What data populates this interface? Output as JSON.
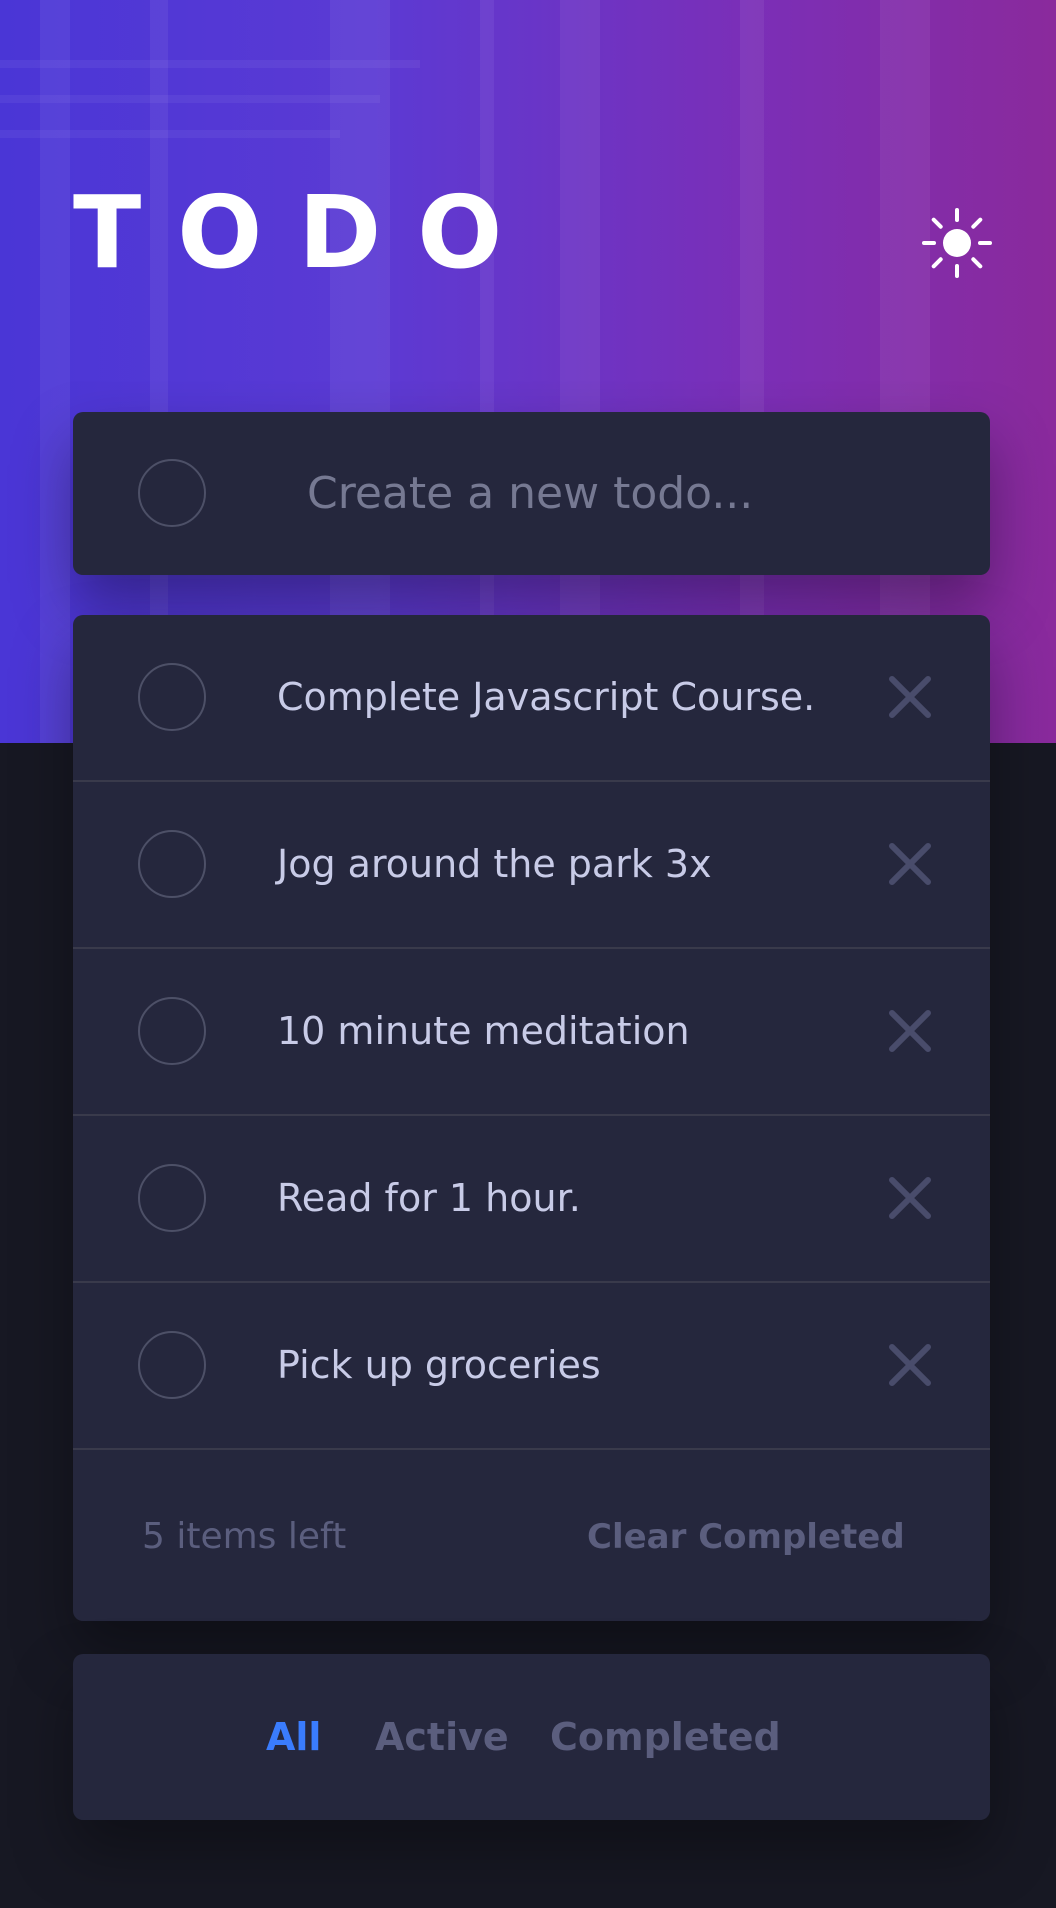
{
  "app": {
    "title": "TODO",
    "theme_icon": "sun-icon"
  },
  "new_todo": {
    "placeholder": "Create a new todo..."
  },
  "todos": [
    {
      "text": "Complete Javascript Course.",
      "completed": false
    },
    {
      "text": "Jog around the park 3x",
      "completed": false
    },
    {
      "text": "10 minute meditation",
      "completed": false
    },
    {
      "text": "Read for 1 hour.",
      "completed": false
    },
    {
      "text": "Pick up groceries",
      "completed": false
    }
  ],
  "footer": {
    "items_left": "5 items left",
    "clear_label": "Clear Completed"
  },
  "filters": [
    {
      "label": "All",
      "active": true
    },
    {
      "label": "Active",
      "active": false
    },
    {
      "label": "Completed",
      "active": false
    }
  ],
  "colors": {
    "accent": "#3a7cfd",
    "card": "#25273d",
    "page_bg": "#171823",
    "todo_text": "#c8cbe7",
    "muted": "#5b5e7e"
  }
}
